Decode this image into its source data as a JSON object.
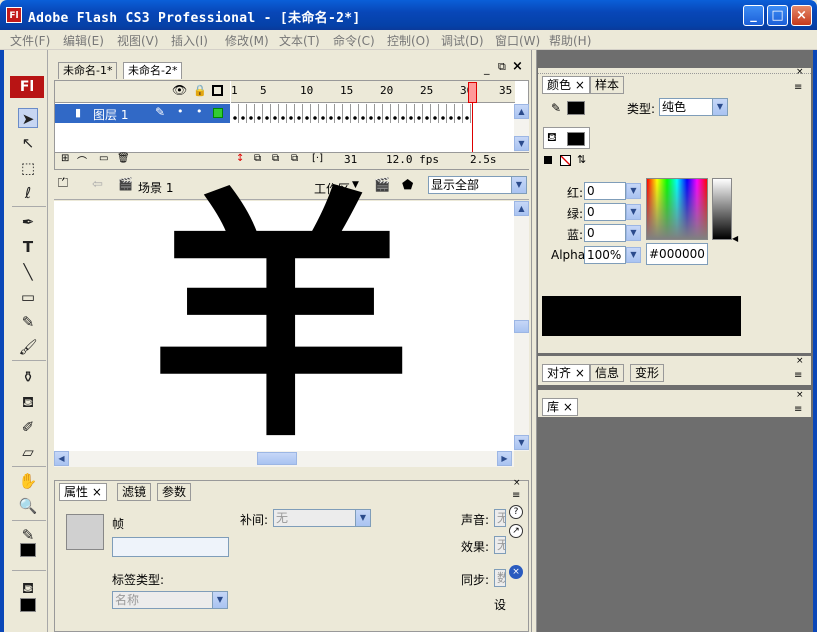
{
  "window": {
    "title": "Adobe Flash CS3 Professional - [未命名-2*]",
    "app_icon": "Fl"
  },
  "menu": [
    "文件(F)",
    "编辑(E)",
    "视图(V)",
    "插入(I)",
    "修改(M)",
    "文本(T)",
    "命令(C)",
    "控制(O)",
    "调试(D)",
    "窗口(W)",
    "帮助(H)"
  ],
  "toolbox": {
    "logo": "Fl"
  },
  "doc_tabs": [
    "未命名-1*",
    "未命名-2*"
  ],
  "timeline": {
    "frame_labels": [
      "1",
      "5",
      "10",
      "15",
      "20",
      "25",
      "30",
      "35"
    ],
    "layer_name": "图层 1",
    "current_frame": "31",
    "fps": "12.0 fps",
    "time": "2.5s"
  },
  "edit_bar": {
    "scene": "场景 1",
    "workspace": "工作区",
    "zoom": "显示全部"
  },
  "stage": {
    "glyph": "羊"
  },
  "properties": {
    "tabs": [
      "属性",
      "滤镜",
      "参数"
    ],
    "frame_label": "帧",
    "tween_label": "补间:",
    "tween_value": "无",
    "label_type_label": "标签类型:",
    "label_type_value": "名称",
    "sound_label": "声音:",
    "sound_value": "无",
    "effect_label": "效果:",
    "effect_value": "无",
    "sync_label": "同步:",
    "sync_value": "数",
    "set_label": "设"
  },
  "color_panel": {
    "tabs": [
      "颜色",
      "样本"
    ],
    "type_label": "类型:",
    "type_value": "纯色",
    "red_label": "红:",
    "red": "0",
    "green_label": "绿:",
    "green": "0",
    "blue_label": "蓝:",
    "blue": "0",
    "alpha_label": "Alpha:",
    "alpha": "100%",
    "hex": "#000000"
  },
  "align_panel": {
    "tabs": [
      "对齐",
      "信息",
      "变形"
    ]
  },
  "library_panel": {
    "tabs": [
      "库"
    ]
  },
  "colors": {
    "accent": "#0a47b8",
    "stroke": "#000000",
    "fill": "#000000",
    "layer_highlight": "#3169c6"
  }
}
